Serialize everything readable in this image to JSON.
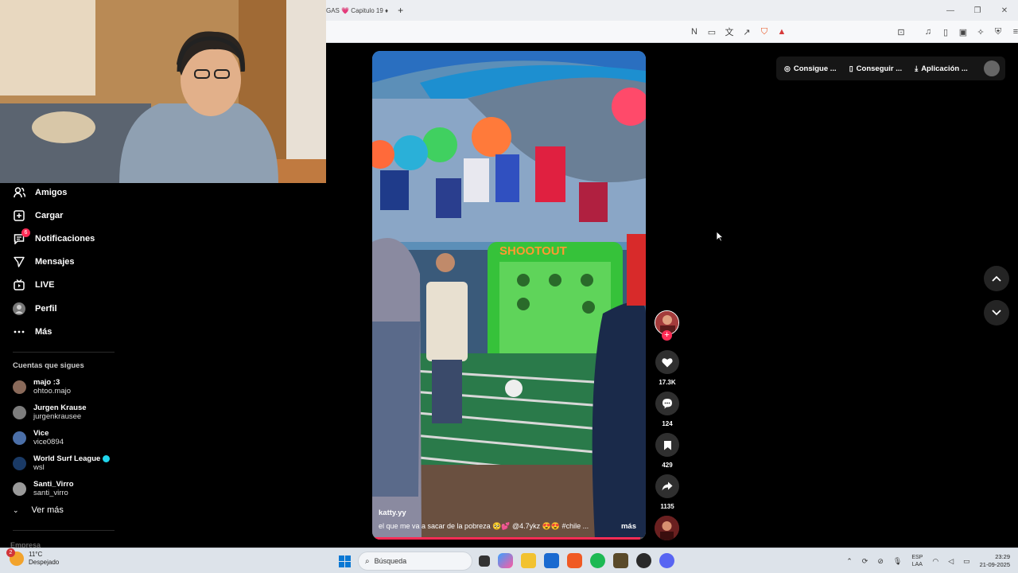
{
  "browser": {
    "tab_title": "GAS 💗 Capitulo 19 ♦",
    "new_tab": "+"
  },
  "sidebar": {
    "items": [
      {
        "label": "Amigos",
        "icon": "friends-icon"
      },
      {
        "label": "Cargar",
        "icon": "upload-icon"
      },
      {
        "label": "Notificaciones",
        "icon": "notifications-icon",
        "badge": "6"
      },
      {
        "label": "Mensajes",
        "icon": "messages-icon"
      },
      {
        "label": "LIVE",
        "icon": "live-icon"
      },
      {
        "label": "Perfil",
        "icon": "profile-icon"
      },
      {
        "label": "Más",
        "icon": "more-icon"
      }
    ],
    "following_header": "Cuentas que sigues",
    "accounts": [
      {
        "name": "majo :3",
        "handle": "ohtoo.majo",
        "color": "#8a6a5a"
      },
      {
        "name": "Jurgen Krause",
        "handle": "jurgenkrausee",
        "color": "#7d7d7d"
      },
      {
        "name": "Vice",
        "handle": "vice0894",
        "color": "#4b6fa8"
      },
      {
        "name": "World Surf League",
        "handle": "wsl",
        "color": "#1a3a66",
        "verified": true
      },
      {
        "name": "Santi_Virro",
        "handle": "santi_virro",
        "color": "#9a9a9a"
      }
    ],
    "see_more": "Ver más",
    "footer_section": "Empresa"
  },
  "video": {
    "author": "katty.yy",
    "caption": "el que me va a sacar de la pobreza 🥺💕 @4.7ykz 😍😍 #chile ...",
    "more": "más",
    "progress": 0.98,
    "banner_text": "SHOOTOUT"
  },
  "actions": {
    "likes": "17.3K",
    "comments": "124",
    "saves": "429",
    "shares": "1135"
  },
  "topbar": {
    "coins": "Consigue ...",
    "get_app": "Conseguir ...",
    "app": "Aplicación ..."
  },
  "taskbar": {
    "weather_badge": "2",
    "temperature": "11°C",
    "condition": "Despejado",
    "search_placeholder": "Búsqueda",
    "lang_1": "ESP",
    "lang_2": "LAA",
    "time": "23:29",
    "date": "21-09-2025"
  },
  "colors": {
    "accent": "#fe2c55",
    "verified": "#20d5ec"
  }
}
